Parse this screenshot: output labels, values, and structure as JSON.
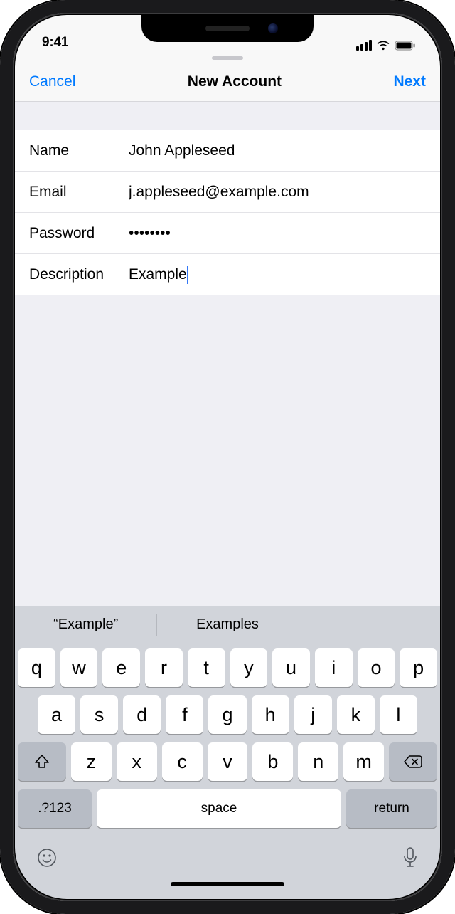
{
  "status": {
    "time": "9:41"
  },
  "nav": {
    "cancel": "Cancel",
    "title": "New Account",
    "next": "Next"
  },
  "form": {
    "name": {
      "label": "Name",
      "value": "John Appleseed"
    },
    "email": {
      "label": "Email",
      "value": "j.appleseed@example.com"
    },
    "password": {
      "label": "Password",
      "value": "••••••••"
    },
    "description": {
      "label": "Description",
      "value": "Example"
    }
  },
  "predictive": {
    "a": "“Example”",
    "b": "Examples"
  },
  "keyboard": {
    "row1": [
      "q",
      "w",
      "e",
      "r",
      "t",
      "y",
      "u",
      "i",
      "o",
      "p"
    ],
    "row2": [
      "a",
      "s",
      "d",
      "f",
      "g",
      "h",
      "j",
      "k",
      "l"
    ],
    "row3": [
      "z",
      "x",
      "c",
      "v",
      "b",
      "n",
      "m"
    ],
    "numbers": ".?123",
    "space": "space",
    "return": "return"
  }
}
